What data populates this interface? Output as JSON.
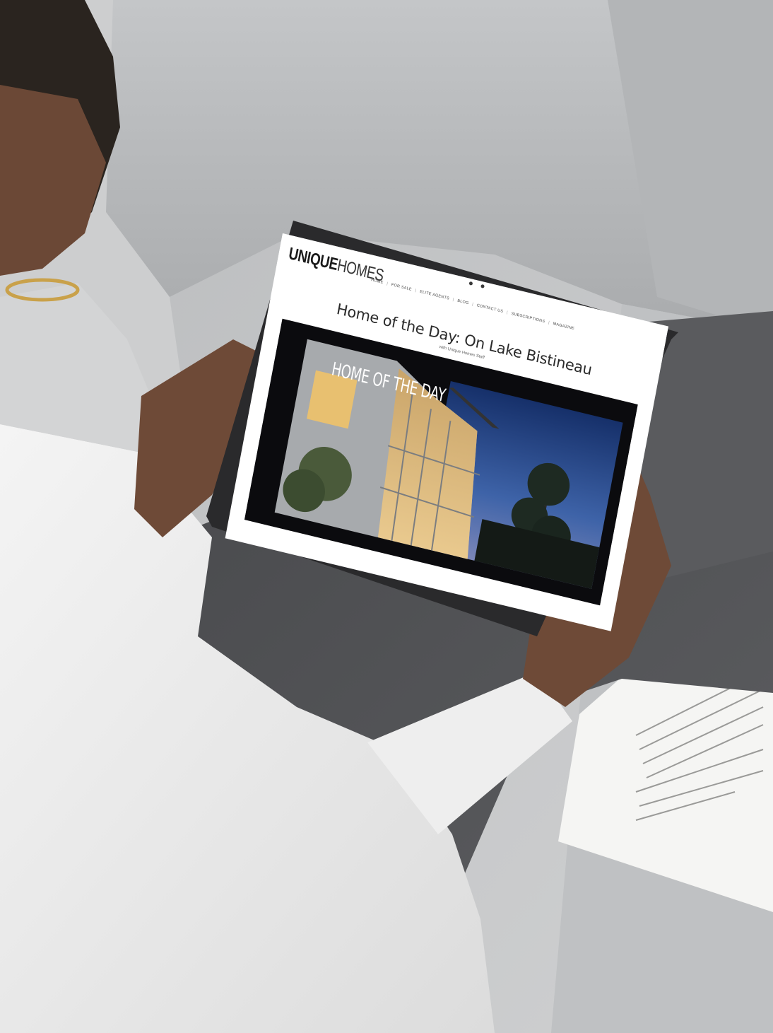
{
  "site": {
    "logo_bold": "UNIQUE",
    "logo_light": "HOMES"
  },
  "nav": {
    "items": [
      {
        "label": "HOME"
      },
      {
        "label": "FOR SALE"
      },
      {
        "label": "ELITE AGENTS"
      },
      {
        "label": "BLOG"
      },
      {
        "label": "CONTACT US"
      },
      {
        "label": "SUBSCRIPTIONS"
      },
      {
        "label": "MAGAZINE"
      }
    ]
  },
  "article": {
    "title": "Home of the Day: On Lake Bistineau",
    "byline": "with Unique Homes Staff",
    "hero_caption": "HOME OF THE DAY"
  }
}
